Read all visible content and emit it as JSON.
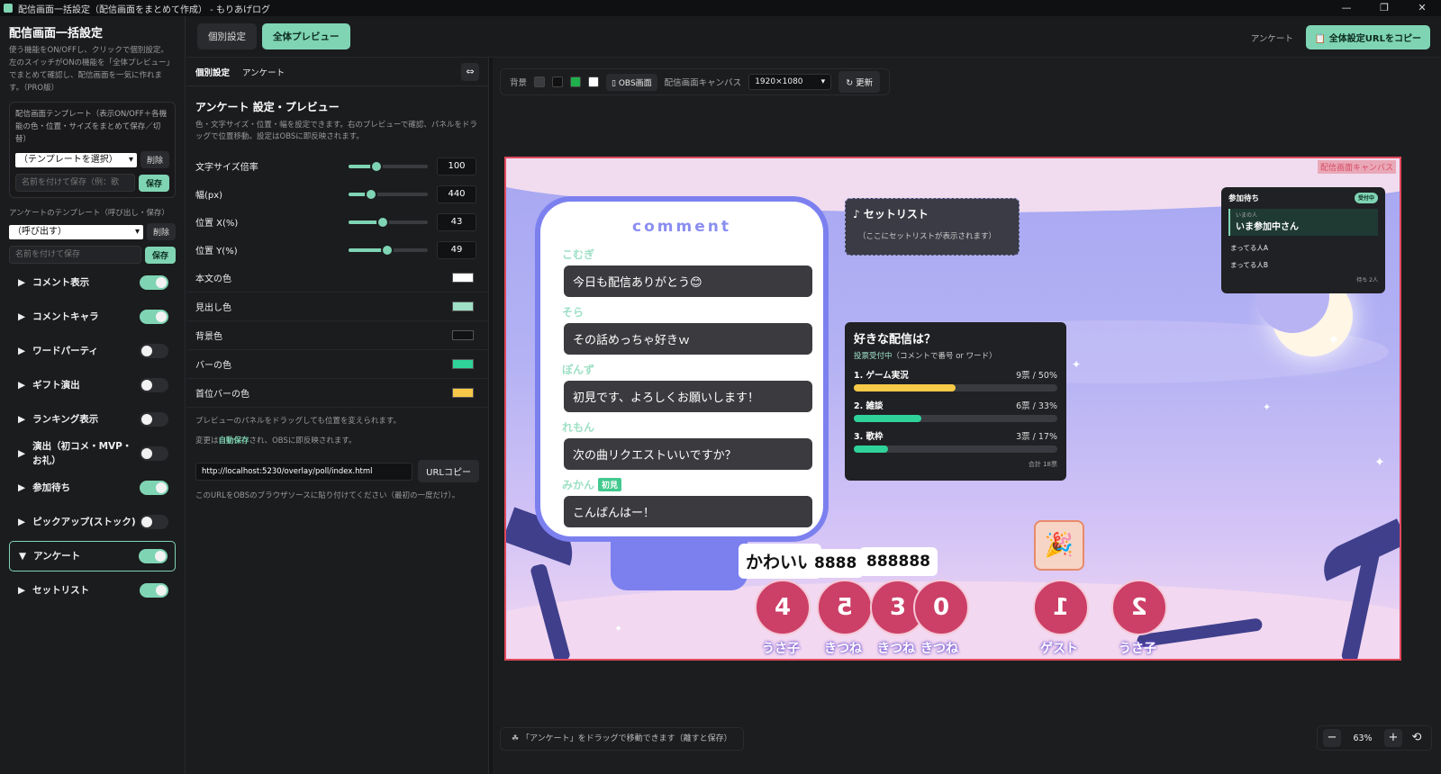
{
  "window": {
    "title": "配信画面一括設定（配信画面をまとめて作成） - もりあげログ",
    "controls": [
      "—",
      "❐",
      "✕"
    ]
  },
  "sidebar": {
    "title": "配信画面一括設定",
    "desc": "使う機能をON/OFFし、クリックで個別設定。左のスイッチがONの機能を「全体プレビュー」でまとめて確認し、配信画面を一気に作れます。（PRO版）",
    "template_label": "配信画面テンプレート（表示ON/OFF＋各機能の色・位置・サイズをまとめて保存／切替）",
    "template_select": "（テンプレートを選択）",
    "delete": "削除",
    "name_placeholder": "名前を付けて保存（例：歌",
    "save": "保存",
    "poll_template_label": "アンケートのテンプレート（呼び出し・保存）",
    "poll_select": "（呼び出す）",
    "poll_name_placeholder": "名前を付けて保存",
    "features": [
      {
        "label": "コメント表示",
        "on": true
      },
      {
        "label": "コメントキャラ",
        "on": true
      },
      {
        "label": "ワードパーティ",
        "on": false
      },
      {
        "label": "ギフト演出",
        "on": false
      },
      {
        "label": "ランキング表示",
        "on": false
      },
      {
        "label": "演出（初コメ・MVP・お礼）",
        "on": false
      },
      {
        "label": "参加待ち",
        "on": true
      },
      {
        "label": "ピックアップ(ストック)",
        "on": false
      },
      {
        "label": "アンケート",
        "on": true,
        "active": true
      },
      {
        "label": "セットリスト",
        "on": true
      }
    ]
  },
  "topbar": {
    "tab_individual": "個別設定",
    "tab_preview": "全体プレビュー",
    "link_poll": "アンケート",
    "copy_url": "全体設定URLをコピー"
  },
  "panel": {
    "sub_individual": "個別設定",
    "sub_poll": "アンケート",
    "title": "アンケート 設定・プレビュー",
    "desc": "色・文字サイズ・位置・幅を設定できます。右のプレビューで確認、パネルをドラッグで位置移動。設定はOBSに即反映されます。",
    "sliders": [
      {
        "label": "文字サイズ倍率",
        "value": "100",
        "pos": 0.35
      },
      {
        "label": "幅(px)",
        "value": "440",
        "pos": 0.28
      },
      {
        "label": "位置 X(%)",
        "value": "43",
        "pos": 0.43
      },
      {
        "label": "位置 Y(%)",
        "value": "49",
        "pos": 0.49
      }
    ],
    "colors": [
      {
        "label": "本文の色",
        "color": "#ffffff"
      },
      {
        "label": "見出し色",
        "color": "#9fe0c6"
      },
      {
        "label": "背景色",
        "color": "#111214"
      },
      {
        "label": "バーの色",
        "color": "#2fd39a"
      },
      {
        "label": "首位バーの色",
        "color": "#f7c948"
      }
    ],
    "note1": "プレビューのパネルをドラッグしても位置を変えられます。",
    "note2_pre": "変更は",
    "note2_bold": "自動保存",
    "note2_post": "され、OBSに即反映されます。",
    "url": "http://localhost:5230/overlay/poll/index.html",
    "url_copy": "URLコピー",
    "url_note": "このURLをOBSのブラウザソースに貼り付けてください（最初の一度だけ）。"
  },
  "toolbar": {
    "bg_label": "背景",
    "obs_label": "OBS画面",
    "canvas_label": "配信画面キャンバス",
    "resolution": "1920×1080",
    "refresh": "↻ 更新"
  },
  "canvas": {
    "label": "配信画面キャンバス",
    "comment_header": "comment",
    "comments": [
      {
        "name": "こむぎ",
        "msg": "今日も配信ありがとう😊",
        "tag": ""
      },
      {
        "name": "そら",
        "msg": "その話めっちゃ好きｗ",
        "tag": ""
      },
      {
        "name": "ぽんず",
        "msg": "初見です、よろしくお願いします！",
        "tag": ""
      },
      {
        "name": "れもん",
        "msg": "次の曲リクエストいいですか？",
        "tag": ""
      },
      {
        "name": "みかん",
        "msg": "こんばんはー！",
        "tag": "初見"
      }
    ],
    "setlist": {
      "title": "♪ セットリスト",
      "sub": "（ここにセットリストが表示されます）"
    },
    "queue": {
      "title": "参加待ち",
      "badge": "受付中",
      "cur_label": "いまの人",
      "current": "いま参加中さん",
      "items": [
        "まってる人A",
        "まってる人B"
      ],
      "footer": "待ち 2人"
    },
    "poll": {
      "question": "好きな配信は？",
      "status": "投票受付中",
      "status_hint": "（コメントで番号 or ワード）",
      "options": [
        {
          "label": "1. ゲーム実況",
          "votes": "9票 / 50%",
          "pct": 50,
          "color": "#f7c948"
        },
        {
          "label": "2. 雑談",
          "votes": "6票 / 33%",
          "pct": 33,
          "color": "#2fd39a"
        },
        {
          "label": "3. 歌枠",
          "votes": "3票 / 17%",
          "pct": 17,
          "color": "#2fd39a"
        }
      ],
      "total": "合計 18票"
    },
    "avatars": [
      {
        "num": "4",
        "name": "うさ子"
      },
      {
        "num": "5",
        "name": "きつね"
      },
      {
        "num": "3",
        "name": "きつね"
      },
      {
        "num": "0",
        "name": "きつね"
      },
      {
        "num": "1",
        "name": "ゲスト"
      },
      {
        "num": "2",
        "name": "うさ子"
      }
    ],
    "bubbles": [
      "かわいい",
      "8888",
      "888888"
    ],
    "gift_icon": "🎉"
  },
  "hint": "「アンケート」をドラッグで移動できます（離すと保存）",
  "zoom": {
    "minus": "−",
    "value": "63%",
    "plus": "+",
    "reset": "⟲"
  }
}
